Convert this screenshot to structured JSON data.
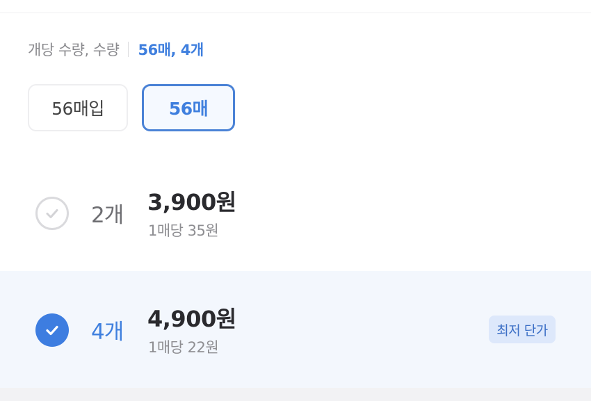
{
  "option": {
    "label": "개당 수량, 수량",
    "selected": "56매, 4개"
  },
  "chips": [
    {
      "label": "56매입",
      "selected": false
    },
    {
      "label": "56매",
      "selected": true
    }
  ],
  "quantities": [
    {
      "qty": "2개",
      "price": "3,900원",
      "unit_price": "1매당 35원",
      "checked": false,
      "badge": ""
    },
    {
      "qty": "4개",
      "price": "4,900원",
      "unit_price": "1매당 22원",
      "checked": true,
      "badge": "최저 단가"
    }
  ],
  "colors": {
    "accent": "#3d7de0",
    "selected_row_bg": "#f3f7fd",
    "badge_bg": "#dde8fb",
    "badge_text": "#3c6fc6"
  },
  "icons": {
    "unchecked": "check-circle-outline-icon",
    "checked": "check-circle-filled-icon"
  }
}
